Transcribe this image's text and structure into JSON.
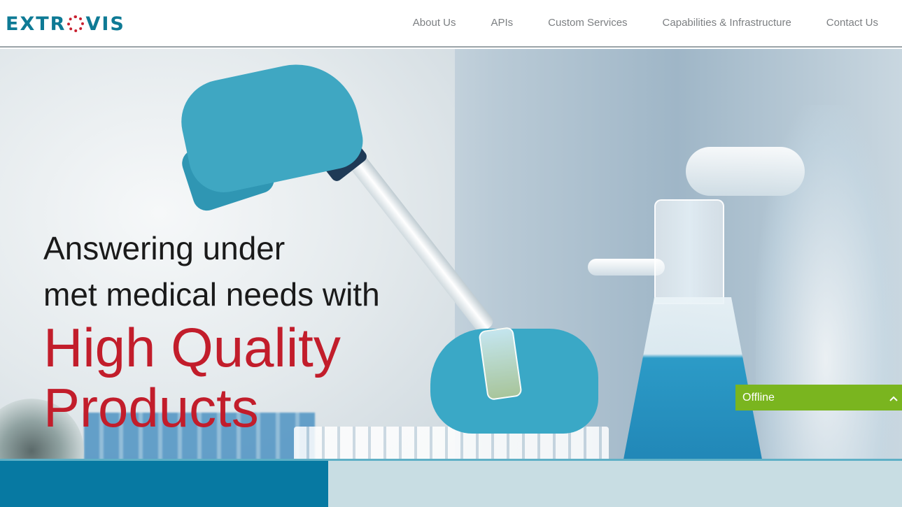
{
  "brand": {
    "logo_text_left": "EXTR",
    "logo_text_right": "VIS",
    "logo_icon": "dotted-ring-o",
    "color_primary": "#0e7a95",
    "color_accent": "#c8202f"
  },
  "nav": {
    "items": [
      {
        "label": "About Us"
      },
      {
        "label": "APIs"
      },
      {
        "label": "Custom Services"
      },
      {
        "label": "Capabilities & Infrastructure"
      },
      {
        "label": "Contact Us"
      }
    ]
  },
  "hero": {
    "line1": "Answering under",
    "line2": "met medical needs with",
    "accent1": "High Quality",
    "accent2": "Products",
    "accent_color": "#c21d2b"
  },
  "chat": {
    "status": "Offline",
    "chevron_icon": "chevron-up-icon",
    "color": "#7ab51f"
  }
}
